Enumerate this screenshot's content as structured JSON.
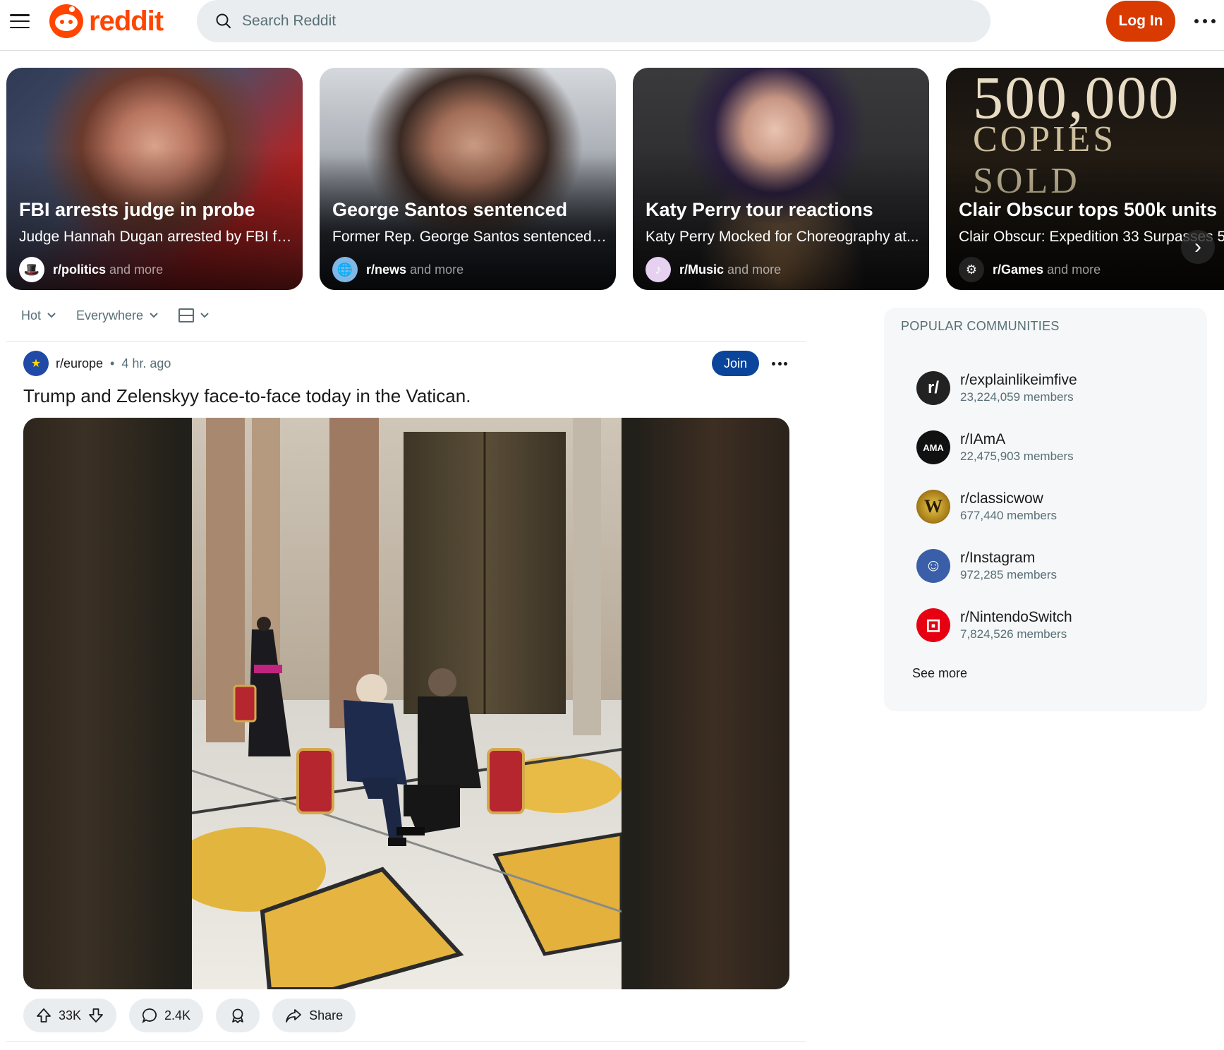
{
  "header": {
    "logo_text": "reddit",
    "search_placeholder": "Search Reddit",
    "login_label": "Log In"
  },
  "trending": [
    {
      "title": "FBI arrests judge in probe",
      "description": "Judge Hannah Dugan arrested by FBI fo...",
      "subreddit": "r/politics",
      "suffix": "and more"
    },
    {
      "title": "George Santos sentenced",
      "description": "Former Rep. George Santos sentenced t...",
      "subreddit": "r/news",
      "suffix": "and more"
    },
    {
      "title": "Katy Perry tour reactions",
      "description": "Katy Perry Mocked for Choreography at...",
      "subreddit": "r/Music",
      "suffix": "and more"
    },
    {
      "title": "Clair Obscur tops 500k units",
      "description": "Clair Obscur: Expedition 33 Surpasses 5...",
      "subreddit": "r/Games",
      "suffix": "and more",
      "overlay_line1": "500,000",
      "overlay_line2": "COPIES SOLD"
    }
  ],
  "sortbar": {
    "sort_label": "Hot",
    "scope_label": "Everywhere"
  },
  "post": {
    "subreddit": "r/europe",
    "separator": "•",
    "time": "4 hr. ago",
    "join_label": "Join",
    "title": "Trump and Zelenskyy face-to-face today in the Vatican.",
    "votes": "33K",
    "comments": "2.4K",
    "share_label": "Share"
  },
  "sidebar": {
    "title": "POPULAR COMMUNITIES",
    "communities": [
      {
        "name": "r/explainlikeimfive",
        "members": "23,224,059 members",
        "icon_text": "r/",
        "color": "#222222"
      },
      {
        "name": "r/IAmA",
        "members": "22,475,903 members",
        "icon_text": "AMA",
        "color": "#111111"
      },
      {
        "name": "r/classicwow",
        "members": "677,440 members",
        "icon_text": "W",
        "color": "#c9a227"
      },
      {
        "name": "r/Instagram",
        "members": "972,285 members",
        "icon_text": "☺",
        "color": "#3a5fa8"
      },
      {
        "name": "r/NintendoSwitch",
        "members": "7,824,526 members",
        "icon_text": "⊡",
        "color": "#e60012"
      }
    ],
    "see_more_label": "See more"
  }
}
